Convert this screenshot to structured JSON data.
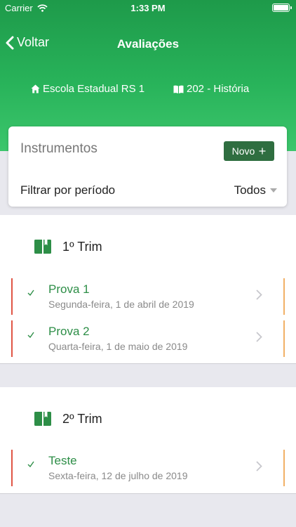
{
  "status_bar": {
    "carrier": "Carrier",
    "time": "1:33 PM"
  },
  "nav": {
    "back_label": "Voltar",
    "title": "Avaliações"
  },
  "context": {
    "school": "Escola Estadual RS 1",
    "class": "202 - História"
  },
  "instruments": {
    "title": "Instrumentos",
    "new_button": "Novo",
    "filter_label": "Filtrar por período",
    "filter_value": "Todos"
  },
  "periods": [
    {
      "name": "1º Trim",
      "items": [
        {
          "title": "Prova 1",
          "date": "Segunda-feira, 1 de abril de 2019"
        },
        {
          "title": "Prova 2",
          "date": "Quarta-feira, 1 de maio de 2019"
        }
      ]
    },
    {
      "name": "2º Trim",
      "items": [
        {
          "title": "Teste",
          "date": "Sexta-feira, 12 de julho de 2019"
        }
      ]
    }
  ],
  "colors": {
    "header_green": "#28b35a",
    "accent_green": "#2d8e47",
    "button_green": "#2f6e40",
    "status_red": "#e05545",
    "status_orange": "#f2b066"
  }
}
